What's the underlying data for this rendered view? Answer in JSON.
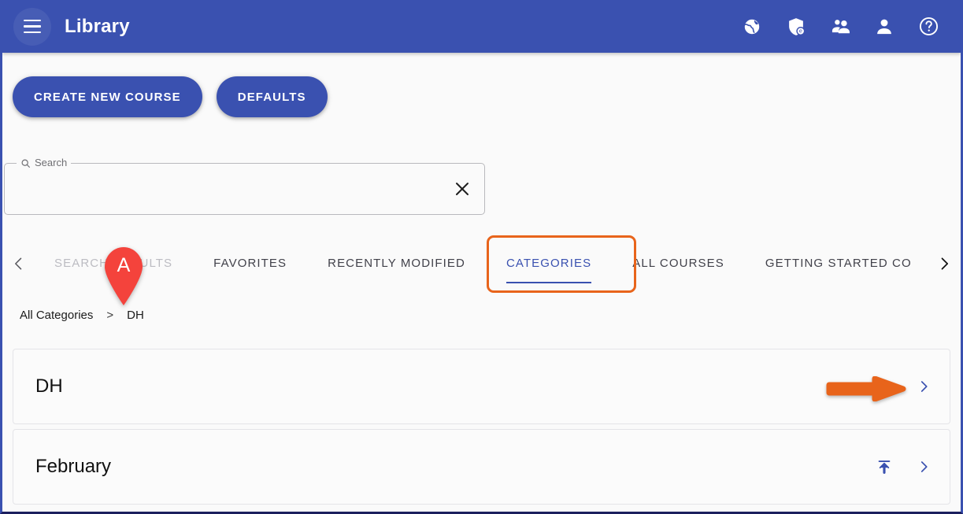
{
  "appbar": {
    "menu_icon": "hamburger-menu-icon",
    "title": "Library",
    "icons": [
      {
        "name": "globe-icon",
        "label": "Language"
      },
      {
        "name": "shield-e-icon",
        "label": "Security"
      },
      {
        "name": "people-group-icon",
        "label": "Groups"
      },
      {
        "name": "person-icon",
        "label": "Account"
      },
      {
        "name": "help-circle-icon",
        "label": "Help"
      }
    ]
  },
  "actions": {
    "create_new_course": "CREATE NEW COURSE",
    "defaults": "DEFAULTS"
  },
  "search": {
    "label": "Search",
    "value": "",
    "placeholder": "",
    "clear_icon": "close-icon",
    "search_icon": "search-icon"
  },
  "tabs": {
    "prev_icon": "chevron-left-icon",
    "next_icon": "chevron-right-icon",
    "items": [
      {
        "label": "SEARCH RESULTS",
        "state": "disabled"
      },
      {
        "label": "FAVORITES",
        "state": "normal"
      },
      {
        "label": "RECENTLY MODIFIED",
        "state": "normal"
      },
      {
        "label": "CATEGORIES",
        "state": "active"
      },
      {
        "label": "ALL COURSES",
        "state": "normal"
      },
      {
        "label": "GETTING STARTED CO",
        "state": "normal"
      }
    ]
  },
  "breadcrumb": {
    "root": "All Categories",
    "separator": ">",
    "current": "DH"
  },
  "list": {
    "rows": [
      {
        "title": "DH",
        "has_publish": false,
        "chevron_icon": "chevron-right-icon"
      },
      {
        "title": "February",
        "has_publish": true,
        "publish_icon": "publish-icon",
        "chevron_icon": "chevron-right-icon"
      }
    ]
  },
  "annotations": {
    "pin_label": "A",
    "pin_color": "#f4433c",
    "box_color": "#e8641b",
    "arrow_color": "#e8641b"
  },
  "colors": {
    "brand": "#3a51b0",
    "page_background": "#fafafa",
    "accent_orange": "#e8641b",
    "pin_red": "#f4433c"
  }
}
